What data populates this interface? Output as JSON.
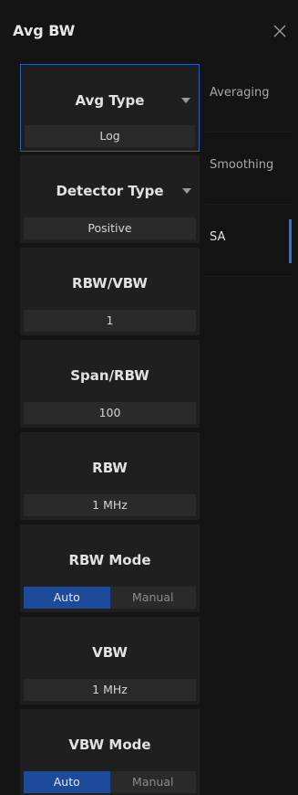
{
  "panel": {
    "title": "Avg BW"
  },
  "tiles": [
    {
      "label": "Avg Type",
      "value": "Log"
    },
    {
      "label": "Detector Type",
      "value": "Positive"
    },
    {
      "label": "RBW/VBW",
      "value": "1"
    },
    {
      "label": "Span/RBW",
      "value": "100"
    },
    {
      "label": "RBW",
      "value": "1 MHz"
    },
    {
      "label": "RBW Mode",
      "options": [
        "Auto",
        "Manual"
      ],
      "selected": "Auto"
    },
    {
      "label": "VBW",
      "value": "1 MHz"
    },
    {
      "label": "VBW Mode",
      "options": [
        "Auto",
        "Manual"
      ],
      "selected": "Auto"
    }
  ],
  "tabs": [
    {
      "label": "Averaging"
    },
    {
      "label": "Smoothing"
    },
    {
      "label": "SA"
    }
  ],
  "active_tab": "SA",
  "colors": {
    "accent": "#2f6fe0",
    "selected_border": "#2a5cb5",
    "active_option": "#1e4a9a"
  }
}
